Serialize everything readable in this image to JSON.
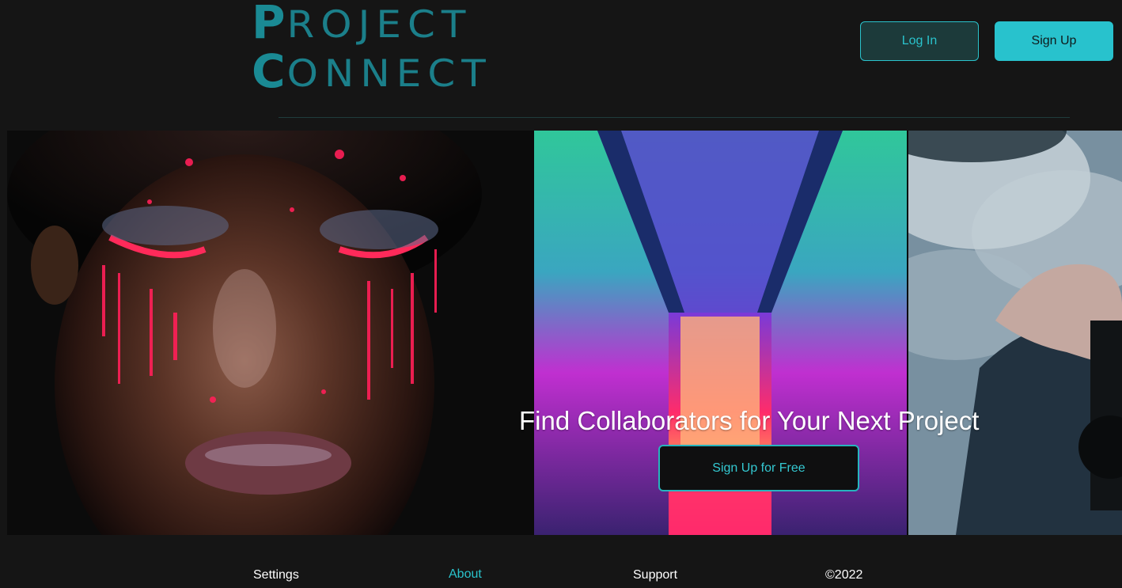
{
  "header": {
    "logo": {
      "line1_cap": "P",
      "line1_rest": "ROJECT",
      "line2_cap": "C",
      "line2_rest": "ONNECT"
    },
    "login_label": "Log In",
    "signup_label": "Sign Up"
  },
  "hero": {
    "title": "Find Collaborators for Your Next Project",
    "cta_label": "Sign Up for Free",
    "images": [
      "face-paint-photo",
      "neon-hallway-photo",
      "camera-smoke-photo"
    ]
  },
  "footer": {
    "settings": "Settings",
    "about": "About",
    "support": "Support",
    "copyright": "©2022"
  },
  "colors": {
    "background": "#151515",
    "accent": "#28c2cd",
    "logo": "#1b8590"
  }
}
